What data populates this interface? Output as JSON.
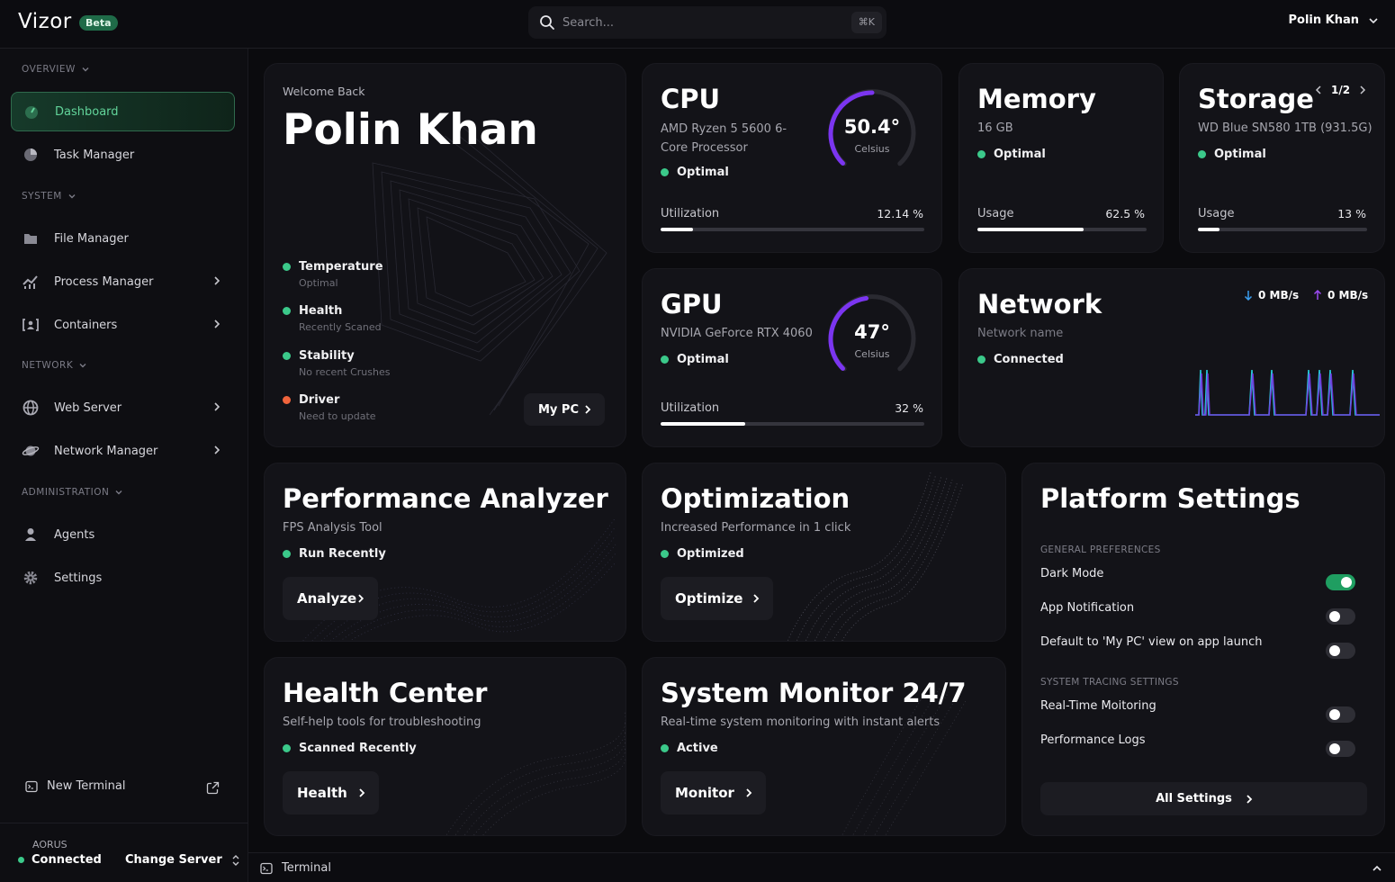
{
  "app": {
    "name": "Vizor",
    "badge": "Beta"
  },
  "search": {
    "placeholder": "Search...",
    "shortcut": "⌘K"
  },
  "user": {
    "name": "Polin Khan"
  },
  "sidebar": {
    "sections": {
      "overview": "OVERVIEW",
      "system": "SYSTEM",
      "network": "NETWORK",
      "administration": "ADMINISTRATION"
    },
    "items": {
      "dashboard": "Dashboard",
      "task_manager": "Task Manager",
      "file_manager": "File Manager",
      "process_manager": "Process Manager",
      "containers": "Containers",
      "web_server": "Web Server",
      "network_manager": "Network Manager",
      "agents": "Agents",
      "settings": "Settings"
    },
    "new_terminal": "New Terminal",
    "server": {
      "name": "AORUS",
      "status": "Connected",
      "change": "Change Server"
    }
  },
  "welcome": {
    "greeting": "Welcome Back",
    "name": "Polin Khan",
    "checks": [
      {
        "title": "Temperature",
        "detail": "Optimal",
        "state": "ok"
      },
      {
        "title": "Health",
        "detail": "Recently Scaned",
        "state": "ok"
      },
      {
        "title": "Stability",
        "detail": "No recent Crushes",
        "state": "ok"
      },
      {
        "title": "Driver",
        "detail": "Need to update",
        "state": "warn"
      }
    ],
    "button": "My PC"
  },
  "cpu": {
    "title": "CPU",
    "model": "AMD Ryzen 5 5600 6-Core Processor",
    "status": "Optimal",
    "temp": "50.4°",
    "temp_unit": "Celsius",
    "temp_level": 0.5,
    "util_label": "Utilization",
    "util_value": "12.14 %",
    "util_fraction": 0.1214
  },
  "memory": {
    "title": "Memory",
    "size": "16 GB",
    "status": "Optimal",
    "usage_label": "Usage",
    "usage_value": "62.5 %",
    "usage_fraction": 0.625
  },
  "storage": {
    "title": "Storage",
    "page": "1/2",
    "drive": "WD Blue SN580 1TB (931.5G)",
    "status": "Optimal",
    "usage_label": "Usage",
    "usage_value": "13 %",
    "usage_fraction": 0.13
  },
  "gpu": {
    "title": "GPU",
    "model": "NVIDIA GeForce RTX 4060",
    "status": "Optimal",
    "temp": "47°",
    "temp_unit": "Celsius",
    "temp_level": 0.47,
    "util_label": "Utilization",
    "util_value": "32 %",
    "util_fraction": 0.32
  },
  "network": {
    "title": "Network",
    "name": "Network name",
    "status": "Connected",
    "down": "0 MB/s",
    "up": "0 MB/s"
  },
  "perf": {
    "title": "Performance Analyzer",
    "subtitle": "FPS Analysis Tool",
    "status": "Run Recently",
    "button": "Analyze"
  },
  "optim": {
    "title": "Optimization",
    "subtitle": "Increased Performance in 1 click",
    "status": "Optimized",
    "button": "Optimize"
  },
  "health": {
    "title": "Health Center",
    "subtitle": "Self-help tools for troubleshooting",
    "status": "Scanned Recently",
    "button": "Health"
  },
  "monitor": {
    "title": "System Monitor 24/7",
    "subtitle": "Real-time system monitoring with instant alerts",
    "status": "Active",
    "button": "Monitor"
  },
  "platform": {
    "title": "Platform Settings",
    "general_label": "GENERAL PREFERENCES",
    "tracing_label": "SYSTEM TRACING SETTINGS",
    "settings": {
      "dark_mode": {
        "label": "Dark Mode",
        "on": true
      },
      "app_notification": {
        "label": "App Notification",
        "on": false
      },
      "default_mypc": {
        "label": "Default to 'My PC' view on app launch",
        "on": false
      },
      "realtime": {
        "label": "Real-Time Moitoring",
        "on": false
      },
      "perf_logs": {
        "label": "Performance Logs",
        "on": false
      }
    },
    "all_settings": "All Settings"
  },
  "terminal": {
    "label": "Terminal"
  },
  "colors": {
    "accent_green": "#3bc98a",
    "gauge_purple": "#7b35f0",
    "net_cyan": "#25c6d6",
    "net_purple": "#7a35e6",
    "warn_orange": "#f0643c"
  }
}
